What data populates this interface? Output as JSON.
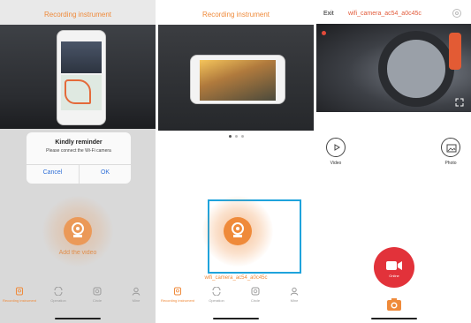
{
  "colors": {
    "accent": "#ef8a3a",
    "highlight": "#1fa3dc",
    "record": "#e2323a",
    "dialog_link": "#2f6fd8"
  },
  "screen1": {
    "title": "Recording instrument",
    "dialog": {
      "title": "Kindly reminder",
      "message": "Please connect the Wi-Fi camera",
      "cancel_label": "Cancel",
      "ok_label": "OK"
    },
    "add_device_label": "Add the video",
    "tabs": [
      {
        "label": "Recording instrument",
        "icon": "recorder-icon",
        "active": true
      },
      {
        "label": "Operation",
        "icon": "operation-icon",
        "active": false
      },
      {
        "label": "Circle",
        "icon": "circle-icon",
        "active": false
      },
      {
        "label": "Mine",
        "icon": "person-icon",
        "active": false
      }
    ]
  },
  "screen2": {
    "title": "Recording instrument",
    "device_name": "wifi_camera_ac54_a0c45c",
    "carousel": {
      "count": 3,
      "current": 1
    },
    "tabs": [
      {
        "label": "Recording instrument",
        "icon": "recorder-icon",
        "active": true
      },
      {
        "label": "Operation",
        "icon": "operation-icon",
        "active": false
      },
      {
        "label": "Circle",
        "icon": "circle-icon",
        "active": false
      },
      {
        "label": "Mine",
        "icon": "person-icon",
        "active": false
      }
    ]
  },
  "screen3": {
    "edit_label": "Exit",
    "title": "wifi_camera_ac54_a0c45c",
    "video_label": "Video",
    "photo_label": "Photo",
    "record_label": "Online"
  }
}
